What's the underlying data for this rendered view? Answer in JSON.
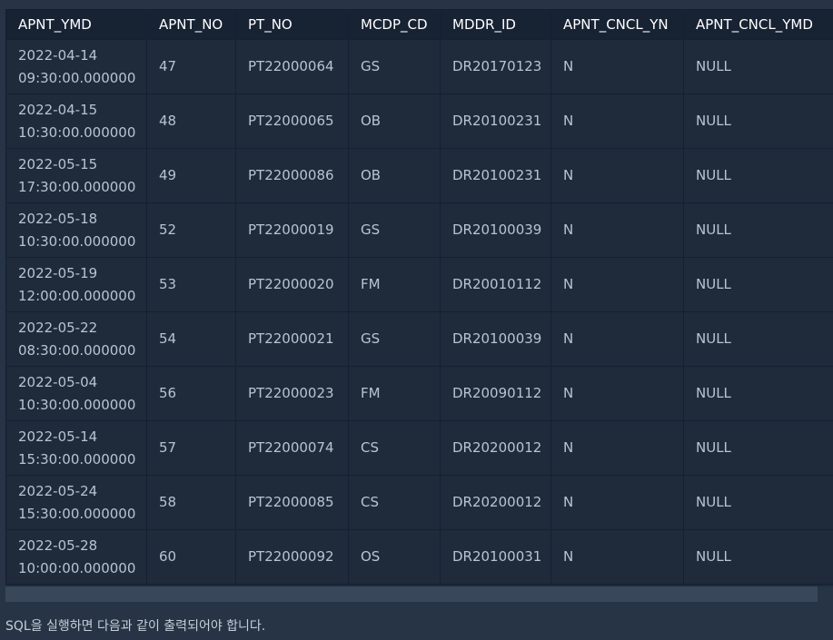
{
  "table": {
    "columns": [
      "APNT_YMD",
      "APNT_NO",
      "PT_NO",
      "MCDP_CD",
      "MDDR_ID",
      "APNT_CNCL_YN",
      "APNT_CNCL_YMD"
    ],
    "rows": [
      {
        "date": "2022-04-14",
        "time": "09:30:00.000000",
        "apnt_no": "47",
        "pt_no": "PT22000064",
        "mcdp_cd": "GS",
        "mddr_id": "DR20170123",
        "cncl_yn": "N",
        "cncl_ymd": "NULL"
      },
      {
        "date": "2022-04-15",
        "time": "10:30:00.000000",
        "apnt_no": "48",
        "pt_no": "PT22000065",
        "mcdp_cd": "OB",
        "mddr_id": "DR20100231",
        "cncl_yn": "N",
        "cncl_ymd": "NULL"
      },
      {
        "date": "2022-05-15",
        "time": "17:30:00.000000",
        "apnt_no": "49",
        "pt_no": "PT22000086",
        "mcdp_cd": "OB",
        "mddr_id": "DR20100231",
        "cncl_yn": "N",
        "cncl_ymd": "NULL"
      },
      {
        "date": "2022-05-18",
        "time": "10:30:00.000000",
        "apnt_no": "52",
        "pt_no": "PT22000019",
        "mcdp_cd": "GS",
        "mddr_id": "DR20100039",
        "cncl_yn": "N",
        "cncl_ymd": "NULL"
      },
      {
        "date": "2022-05-19",
        "time": "12:00:00.000000",
        "apnt_no": "53",
        "pt_no": "PT22000020",
        "mcdp_cd": "FM",
        "mddr_id": "DR20010112",
        "cncl_yn": "N",
        "cncl_ymd": "NULL"
      },
      {
        "date": "2022-05-22",
        "time": "08:30:00.000000",
        "apnt_no": "54",
        "pt_no": "PT22000021",
        "mcdp_cd": "GS",
        "mddr_id": "DR20100039",
        "cncl_yn": "N",
        "cncl_ymd": "NULL"
      },
      {
        "date": "2022-05-04",
        "time": "10:30:00.000000",
        "apnt_no": "56",
        "pt_no": "PT22000023",
        "mcdp_cd": "FM",
        "mddr_id": "DR20090112",
        "cncl_yn": "N",
        "cncl_ymd": "NULL"
      },
      {
        "date": "2022-05-14",
        "time": "15:30:00.000000",
        "apnt_no": "57",
        "pt_no": "PT22000074",
        "mcdp_cd": "CS",
        "mddr_id": "DR20200012",
        "cncl_yn": "N",
        "cncl_ymd": "NULL"
      },
      {
        "date": "2022-05-24",
        "time": "15:30:00.000000",
        "apnt_no": "58",
        "pt_no": "PT22000085",
        "mcdp_cd": "CS",
        "mddr_id": "DR20200012",
        "cncl_yn": "N",
        "cncl_ymd": "NULL"
      },
      {
        "date": "2022-05-28",
        "time": "10:00:00.000000",
        "apnt_no": "60",
        "pt_no": "PT22000092",
        "mcdp_cd": "OS",
        "mddr_id": "DR20100031",
        "cncl_yn": "N",
        "cncl_ymd": "NULL"
      }
    ]
  },
  "caption": "SQL을 실행하면 다음과 같이 출력되어야 합니다.",
  "colors": {
    "page_background": "#263445",
    "table_background": "#1f2a3a",
    "header_background": "#172233",
    "border": "#142033",
    "cell_text": "#b9c4d0",
    "header_text": "#ffffff",
    "scrollbar": "#38485a"
  }
}
